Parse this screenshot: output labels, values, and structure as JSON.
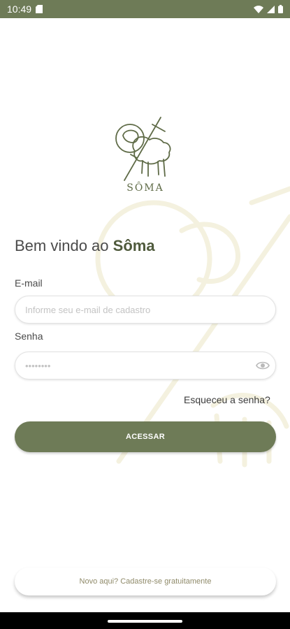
{
  "status_bar": {
    "time": "10:49"
  },
  "brand": {
    "name": "SÔMA"
  },
  "welcome": {
    "prefix": "Bem vindo ao ",
    "brand": "Sôma"
  },
  "form": {
    "email_label": "E-mail",
    "email_placeholder": "Informe seu e-mail de cadastro",
    "password_label": "Senha",
    "password_mask": "••••••••",
    "forgot_link": "Esqueceu a senha?",
    "submit_label": "ACESSAR"
  },
  "signup": {
    "label": "Novo aqui? Cadastre-se gratuitamente"
  },
  "colors": {
    "primary": "#6e7b57",
    "watermark": "#f4f1df",
    "muted_text": "#8f8a69"
  }
}
